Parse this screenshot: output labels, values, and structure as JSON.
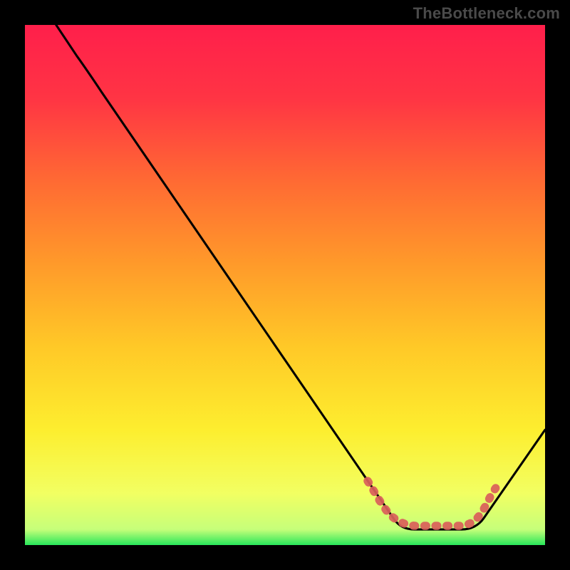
{
  "watermark": "TheBottleneck.com",
  "colors": {
    "background_outer": "#000000",
    "gradient_top": "#ff1f4b",
    "gradient_mid": "#ffc927",
    "gradient_bottom": "#27e65a",
    "curve": "#000000",
    "flat_marker": "#d9605a"
  },
  "chart_data": {
    "type": "line",
    "title": "",
    "xlabel": "",
    "ylabel": "",
    "xlim": [
      0,
      100
    ],
    "ylim": [
      0,
      100
    ],
    "grid": false,
    "legend": false,
    "annotations": [],
    "series": [
      {
        "name": "bottleneck-curve",
        "color": "#000000",
        "x": [
          6,
          10,
          12,
          14,
          16,
          20,
          30,
          40,
          50,
          60,
          65,
          70,
          73,
          75,
          78,
          80,
          82,
          84,
          86,
          88,
          92,
          96,
          100
        ],
        "y": [
          100,
          94,
          91.3,
          88,
          85,
          79,
          64,
          49.5,
          35,
          20.5,
          13,
          6.1,
          3.1,
          3,
          3,
          3,
          3,
          3,
          3.3,
          5.2,
          10.6,
          16.3,
          22.2
        ]
      },
      {
        "name": "optimal-band-marker",
        "color": "#d9605a",
        "style": "dotted",
        "x": [
          66,
          68,
          70,
          72,
          74,
          76,
          78,
          80,
          82,
          84,
          86,
          88,
          90
        ],
        "y": [
          12,
          9,
          6,
          4.2,
          3.6,
          3.6,
          3.6,
          3.6,
          3.6,
          3.8,
          5,
          8,
          11
        ]
      }
    ]
  }
}
